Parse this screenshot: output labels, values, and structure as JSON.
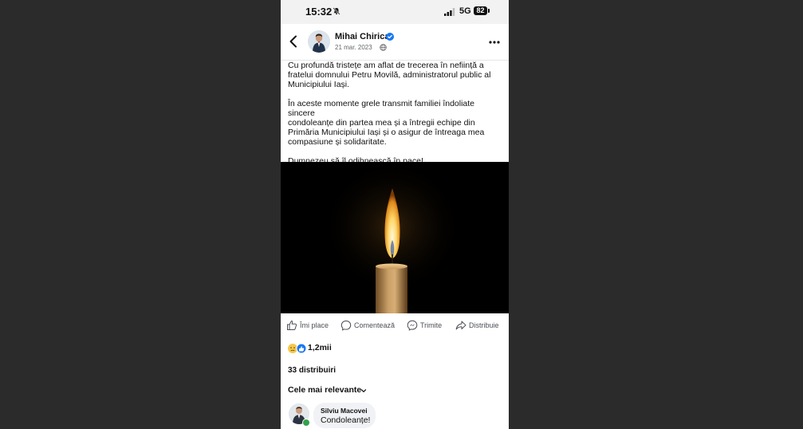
{
  "status_bar": {
    "time": "15:32",
    "network": "5G",
    "battery": "82"
  },
  "post": {
    "author": "Mihai Chirica",
    "date": "21 mar. 2023",
    "text": "Cu profundă tristețe am aflat de trecerea în neființă a\nfratelui domnului Petru Movilă, administratorul public al\nMunicipiului Iași.\n\nÎn aceste momente grele transmit familiei îndoliate sincere\ncondoleanțe din partea mea și a întregii echipe din\nPrimăria Municipiului Iași și o asigur de întreaga mea\ncompasiune și solidaritate.\n\nDumnezeu să îl odihnească în pace!",
    "image": "candle"
  },
  "actions": {
    "like": "Îmi place",
    "comment": "Comentează",
    "send": "Trimite",
    "share": "Distribuie"
  },
  "engagement": {
    "reactions_count": "1,2mii",
    "shares": "33 distribuiri",
    "sort_label": "Cele mai relevante"
  },
  "comment": {
    "author": "Silviu Macovei",
    "text": "Condoleanțe!"
  },
  "colors": {
    "accent": "#1877f2",
    "online": "#31a24c"
  }
}
